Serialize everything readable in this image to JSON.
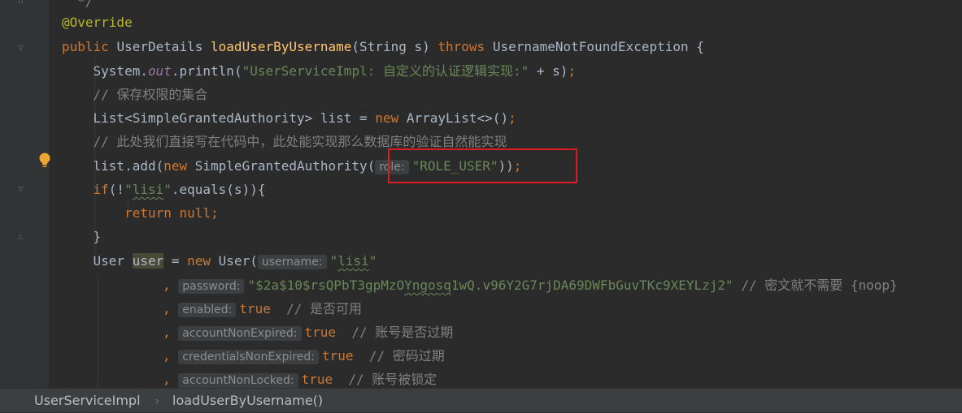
{
  "code": {
    "line0": "*/",
    "line1": "@Override",
    "line2": {
      "kw_public": "public ",
      "type": "UserDetails ",
      "method": "loadUserByUsername",
      "params": "(String s) ",
      "kw_throws": "throws ",
      "rest": "UsernameNotFoundException {"
    },
    "line3": {
      "a": "System.",
      "out": "out",
      "b": ".println(",
      "str": "\"UserServiceImpl: 自定义的认证逻辑实现:\"",
      "c": " + s)",
      "semi": ";"
    },
    "line4": "// 保存权限的集合",
    "line5": {
      "a": "List<SimpleGrantedAuthority> list = ",
      "kw_new": "new ",
      "b": "ArrayList<>()",
      "semi": ";"
    },
    "line6": "// 此处我们直接写在代码中，此处能实现那么数据库的验证自然能实现",
    "line7": {
      "a": "list.add(",
      "kw_new": "new ",
      "b": "SimpleGrantedAuthority(",
      "hint": "role:",
      "str": "\"ROLE_USER\"",
      "c": "))",
      "semi": ";"
    },
    "line8": {
      "kw_if": "if",
      "a": "(!",
      "str_pre": "\"",
      "str_mid": "lisi",
      "str_post": "\"",
      "b": ".equals(s)){"
    },
    "line9": {
      "kw_return": "return ",
      "kw_null": "null",
      "semi": ";"
    },
    "line10": "}",
    "line11": {
      "a": "User ",
      "var": "user",
      "b": " = ",
      "kw_new": "new ",
      "c": "User(",
      "hint": "username:",
      "str_pre": "\"",
      "str_mid": "lisi",
      "str_post": "\""
    },
    "line12": {
      "comma": ", ",
      "hint": "password:",
      "str_pre": "\"$2a$10$rsQPbT3gpMzO",
      "str_mid": "Yngosq",
      "str_post": "1wQ.v96Y2G7rjDA69DWFbGuvTKc9XEYLzj2\"",
      "cmt": " // 密文就不需要 {noop}"
    },
    "line13": {
      "comma": ", ",
      "hint": "enabled:",
      "val": "true",
      "cmt": "  // 是否可用"
    },
    "line14": {
      "comma": ", ",
      "hint": "accountNonExpired:",
      "val": "true",
      "cmt": "  // 账号是否过期"
    },
    "line15": {
      "comma": ", ",
      "hint": "credentialsNonExpired:",
      "val": "true",
      "cmt": "  // 密码过期"
    },
    "line16": {
      "comma": ", ",
      "hint": "accountNonLocked:",
      "val": "true",
      "cmt": "  // 账号被锁定"
    }
  },
  "breadcrumb": {
    "class": "UserServiceImpl",
    "separator": "›",
    "method": "loadUserByUsername()"
  },
  "colors": {
    "background": "#2b2b2b",
    "keyword": "#cc7832",
    "string": "#6a8759",
    "annotation": "#bbb529",
    "method": "#ffc66d",
    "highlight_box": "#e01b24"
  }
}
